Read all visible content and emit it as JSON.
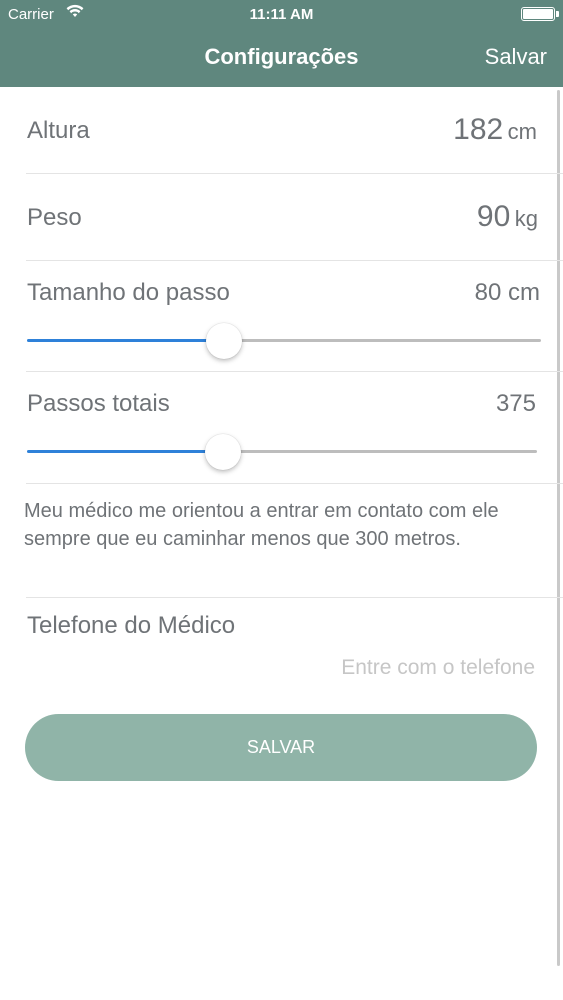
{
  "status_bar": {
    "carrier": "Carrier",
    "time": "11:11 AM",
    "wifi_icon": "wifi-icon",
    "battery_icon": "battery-icon",
    "battery_level": 1.0
  },
  "nav": {
    "title": "Configurações",
    "save_label": "Salvar",
    "background_color": "#5f877e"
  },
  "settings": {
    "height": {
      "label": "Altura",
      "value": "182",
      "unit": "cm"
    },
    "weight": {
      "label": "Peso",
      "value": "90",
      "unit": "kg"
    },
    "step_size": {
      "label": "Tamanho do passo",
      "value_text": "80 cm",
      "slider_fraction": 0.375
    },
    "total_steps": {
      "label": "Passos totais",
      "value_text": "375",
      "slider_fraction": 0.375
    }
  },
  "note": "Meu médico me orientou a entrar em contato com ele sempre que eu caminhar menos que 300 metros.",
  "doctor_phone": {
    "label": "Telefone do Médico",
    "value": "",
    "placeholder": "Entre com o telefone"
  },
  "save_button": {
    "label": "SALVAR",
    "color": "#90b4a8"
  },
  "slider_color": "#2e81d9"
}
